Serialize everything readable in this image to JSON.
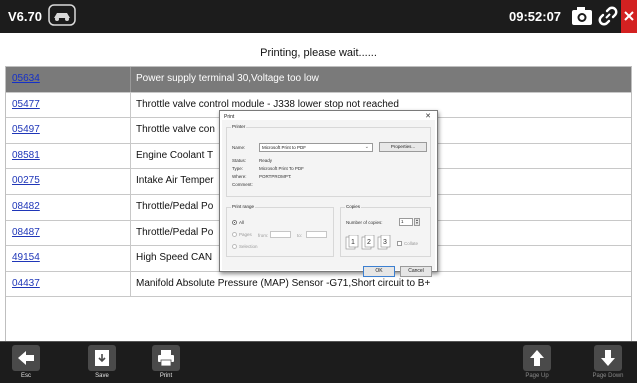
{
  "topbar": {
    "version": "V6.70",
    "clock": "09:52:07",
    "icons": [
      "car-logo-icon",
      "camera-icon",
      "link-icon",
      "close-icon"
    ],
    "close_color": "#d32121"
  },
  "status": "Printing, please wait......",
  "dtc_rows": [
    {
      "code": "05634",
      "desc": "Power supply terminal 30,Voltage too low"
    },
    {
      "code": "05477",
      "desc": "Throttle valve control module - J338 lower stop not reached"
    },
    {
      "code": "05497",
      "desc": "Throttle valve con"
    },
    {
      "code": "08581",
      "desc": "Engine Coolant T"
    },
    {
      "code": "00275",
      "desc": "Intake Air Temper"
    },
    {
      "code": "08482",
      "desc": "Throttle/Pedal Po"
    },
    {
      "code": "08487",
      "desc": "Throttle/Pedal Po"
    },
    {
      "code": "49154",
      "desc": "High Speed CAN"
    },
    {
      "code": "04437",
      "desc": "Manifold Absolute Pressure (MAP) Sensor -G71,Short circuit to B+"
    }
  ],
  "selected_row": 0,
  "print_dialog": {
    "title": "Print",
    "close": "✕",
    "printer_group": "Printer",
    "name_label": "Name:",
    "name_value": "Microsoft Print to PDF",
    "properties": "Properties...",
    "status_label": "Status:",
    "status_value": "Ready",
    "type_label": "Type:",
    "type_value": "Microsoft Print To PDF",
    "where_label": "Where:",
    "where_value": "PORTPROMPT:",
    "comment_label": "Comment:",
    "range_group": "Print range",
    "range_all": "All",
    "range_pages": "Pages",
    "from_label": "from:",
    "to_label": "to:",
    "range_selection": "Selection",
    "copies_group": "Copies",
    "copies_label": "Number of copies:",
    "copies_value": "1",
    "collate": "Collate",
    "ok": "OK",
    "cancel": "Cancel"
  },
  "toolbar": {
    "esc": "Esc",
    "save": "Save",
    "print": "Print",
    "page_up": "Page Up",
    "page_down": "Page Down"
  }
}
